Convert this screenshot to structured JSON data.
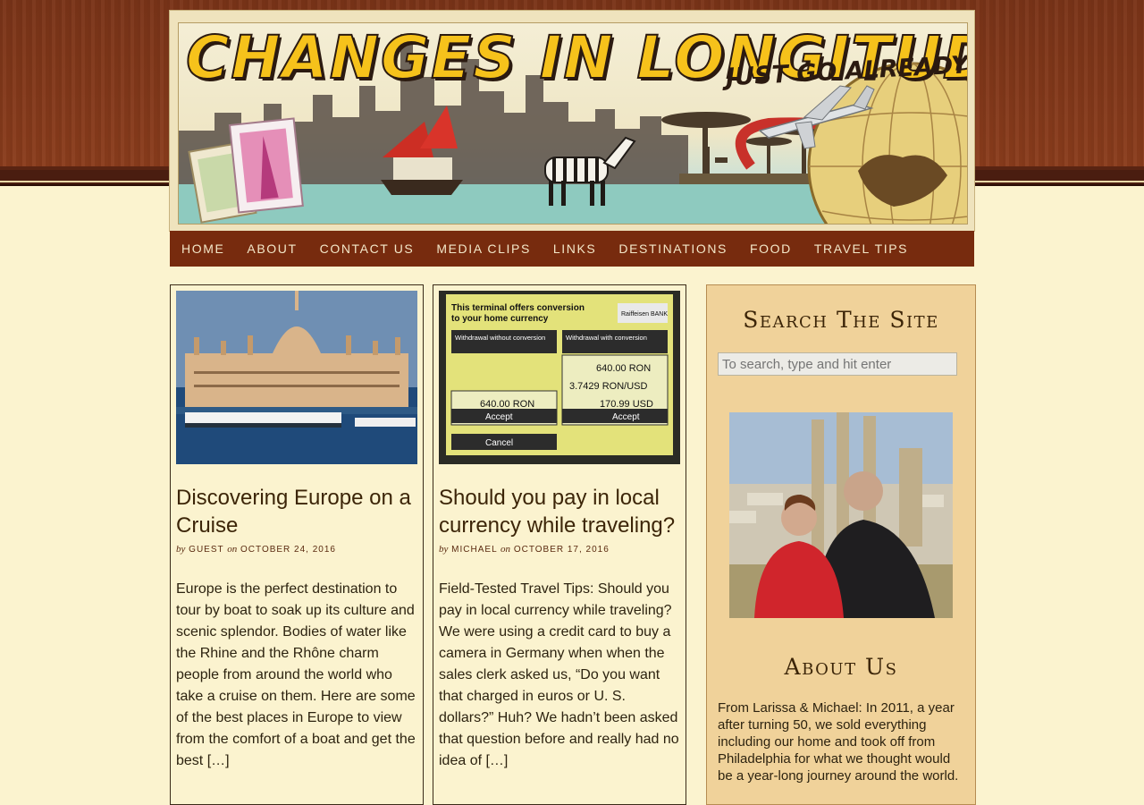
{
  "site": {
    "title": "CHANGES IN LONGITUDE",
    "tagline": "JUST GO ALREADY!"
  },
  "nav": {
    "items": [
      {
        "label": "HOME"
      },
      {
        "label": "ABOUT"
      },
      {
        "label": "CONTACT US"
      },
      {
        "label": "MEDIA CLIPS"
      },
      {
        "label": "LINKS"
      },
      {
        "label": "DESTINATIONS"
      },
      {
        "label": "FOOD"
      },
      {
        "label": "TRAVEL TIPS"
      }
    ]
  },
  "posts": [
    {
      "title": "Discovering Europe on a Cruise",
      "by": "by",
      "author": "GUEST",
      "on": "on",
      "date": "OCTOBER 24, 2016",
      "excerpt": "Europe is the perfect destination to tour by boat to soak up its culture and scenic splendor. Bodies of water like the Rhine and the Rhône charm people from around the world who take a cruise on them. Here are some of the best places in Europe to view from the comfort of a boat and get the best […]"
    },
    {
      "title": "Should you pay in local currency while traveling?",
      "by": "by",
      "author": "MICHAEL",
      "on": "on",
      "date": "OCTOBER 17, 2016",
      "excerpt": "Field-Tested Travel Tips: Should you pay in local currency while traveling? We were using a credit card to buy a camera in Germany when when the sales clerk asked us, “Do you want that charged in euros or U. S. dollars?” Huh? We hadn’t been asked that question before and really had no idea of […]"
    }
  ],
  "atm": {
    "line1": "This terminal offers conversion",
    "line2": "to your home currency",
    "bank": "Raiffeisen BANK",
    "left_head": "Withdrawal without conversion",
    "right_head": "Withdrawal with conversion",
    "withdrawal_amount": "640.00 RON",
    "exchange_rate": "3.7429 RON/USD",
    "left_charge": "640.00 RON",
    "right_charge": "170.99 USD",
    "accept": "Accept",
    "cancel": "Cancel"
  },
  "sidebar": {
    "search_heading": "Search The Site",
    "search_placeholder": "To search, type and hit enter",
    "about_heading": "About Us",
    "about_text": "From Larissa & Michael: In 2011, a year after turning 50, we sold everything including our home and took off from Philadelphia for what we thought would be a year-long journey around the world."
  }
}
